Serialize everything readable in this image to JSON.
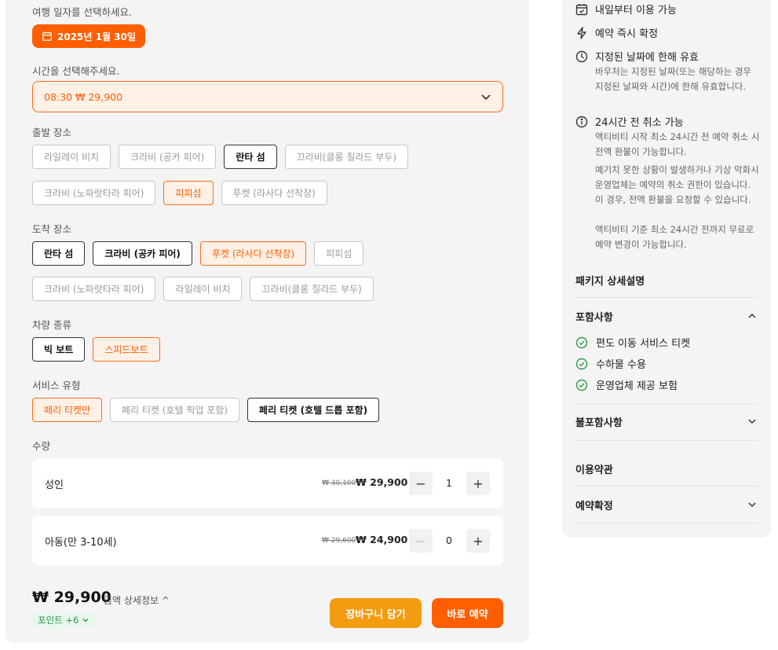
{
  "date_section": {
    "label": "여행 일자를 선택하세요.",
    "selected_date": "2025년 1월 30일"
  },
  "time_section": {
    "label": "시간을 선택해주세요.",
    "selected": "08:30 ₩ 29,900"
  },
  "departure": {
    "label": "출발 장소",
    "options": [
      {
        "label": "라일레이 비치",
        "state": "disabled"
      },
      {
        "label": "크라비 (공카 피어)",
        "state": "disabled"
      },
      {
        "label": "란타 섬",
        "state": "available"
      },
      {
        "label": "끄라비(클롱 질라드 부두)",
        "state": "disabled"
      },
      {
        "label": "크라비 (노파랏타라 피어)",
        "state": "disabled"
      },
      {
        "label": "피피섬",
        "state": "selected"
      },
      {
        "label": "푸켓 (라사다 선착장)",
        "state": "disabled"
      }
    ]
  },
  "arrival": {
    "label": "도착 장소",
    "options": [
      {
        "label": "란타 섬",
        "state": "available"
      },
      {
        "label": "크라비 (공카 피어)",
        "state": "available"
      },
      {
        "label": "푸켓 (라사다 선착장)",
        "state": "selected"
      },
      {
        "label": "피피섬",
        "state": "disabled"
      },
      {
        "label": "크라비 (노파랏타라 피어)",
        "state": "disabled"
      },
      {
        "label": "라일레이 비치",
        "state": "disabled"
      },
      {
        "label": "끄라비(클롱 질라드 부두)",
        "state": "disabled"
      }
    ]
  },
  "vehicle": {
    "label": "차량 종류",
    "options": [
      {
        "label": "빅 보트",
        "state": "available"
      },
      {
        "label": "스피드보트",
        "state": "selected"
      }
    ]
  },
  "service": {
    "label": "서비스 유형",
    "options": [
      {
        "label": "페리 티켓만",
        "state": "selected"
      },
      {
        "label": "페리 티켓 (호텔 픽업 포함)",
        "state": "disabled"
      },
      {
        "label": "페리 티켓 (호텔 드롭 포함)",
        "state": "available"
      }
    ]
  },
  "quantity": {
    "label": "수량",
    "items": [
      {
        "name": "성인",
        "original_price": "₩ 30,100",
        "price": "₩ 29,900",
        "count": "1",
        "minus": "−",
        "plus": "+"
      },
      {
        "name": "아동(만 3-10세)",
        "original_price": "₩ 29,600",
        "price": "₩ 24,900",
        "count": "0",
        "minus": "−",
        "plus": "+"
      }
    ]
  },
  "footer": {
    "total": "₩ 29,900",
    "detail": "금액 상세정보 ^",
    "points": "포인트 +6",
    "cart": "장바구니 담기",
    "book": "바로 예약"
  },
  "right": {
    "features": [
      {
        "icon": "calendar-check-icon",
        "title": "내일부터 이용 가능"
      },
      {
        "icon": "lightning-icon",
        "title": "예약 즉시 확정"
      },
      {
        "icon": "clock-icon",
        "title": "지정된 날짜에 한해 유효",
        "desc": [
          "바우처는 지정된 날짜(또는 해당하는 경우 지정된 날짜와 시간)에 한해 유효합니다."
        ]
      },
      {
        "icon": "info-icon",
        "title": "24시간 전 취소 가능",
        "desc": [
          "액티비티 시작 최소 24시간 전 예약 취소 시 전액 환불이 가능합니다.",
          "예기치 못한 상황이 발생하거나 기상 악화시 운영업체는 예약의 취소 권한이 있습니다. 이 경우, 전액 환불을 요청할 수 있습니다.",
          "액티비티 기준 최소 24시간 전까지 무료로 예약 변경이 가능합니다."
        ]
      }
    ],
    "package_title": "패키지 상세설명",
    "included_title": "포함사항",
    "included": [
      "편도 이동 서비스 티켓",
      "수하물 수용",
      "운영업체 제공 보험"
    ],
    "excluded_title": "불포함사항",
    "terms_title": "이용약관",
    "confirm_title": "예약확정"
  },
  "colors": {
    "accent": "#ff5f00",
    "cart": "#f39c12",
    "success": "#2e9a4d"
  }
}
